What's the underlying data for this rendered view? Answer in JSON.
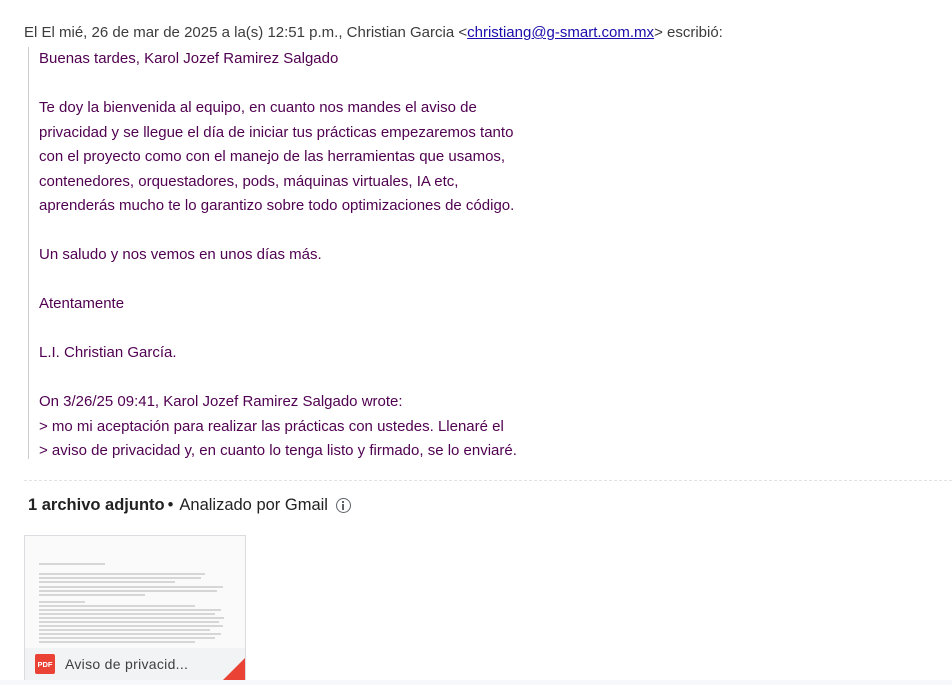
{
  "header": {
    "prefix": "El El mié, 26 de mar de 2025 a la(s) 12:51 p.m., Christian Garcia <",
    "email": "christiang@g-smart.com.mx",
    "suffix": "> escribió:"
  },
  "quote": {
    "greeting": "Buenas tardes, Karol Jozef Ramirez Salgado",
    "para1": [
      "Te doy la bienvenida al equipo, en cuanto nos mandes el aviso de",
      "privacidad y se llegue el día de iniciar tus prácticas empezaremos tanto",
      "con el proyecto como con el manejo de las herramientas que usamos,",
      "contenedores, orquestadores, pods, máquinas virtuales, IA etc,",
      "aprenderás mucho te lo garantizo sobre todo optimizaciones de código."
    ],
    "closing": "Un saludo y nos vemos en unos días más.",
    "signoff": "Atentamente",
    "signature": "L.I. Christian García.",
    "wrote": "On 3/26/25 09:41, Karol Jozef Ramirez Salgado wrote:",
    "nested": [
      "> mo mi aceptación para realizar las prácticas con ustedes. Llenaré el",
      "> aviso de privacidad y, en cuanto lo tenga listo y firmado, se lo enviaré."
    ]
  },
  "attachments": {
    "count_label": "1 archivo adjunto",
    "dot": "•",
    "scanned_label": "Analizado por Gmail",
    "info_icon": "info-icon",
    "file": {
      "name": "Aviso de privacid...",
      "type_label": "PDF",
      "icon": "pdf-icon"
    }
  },
  "colors": {
    "quote_text": "#500050",
    "link": "#1a0dab",
    "pdf_red": "#ea4335"
  }
}
